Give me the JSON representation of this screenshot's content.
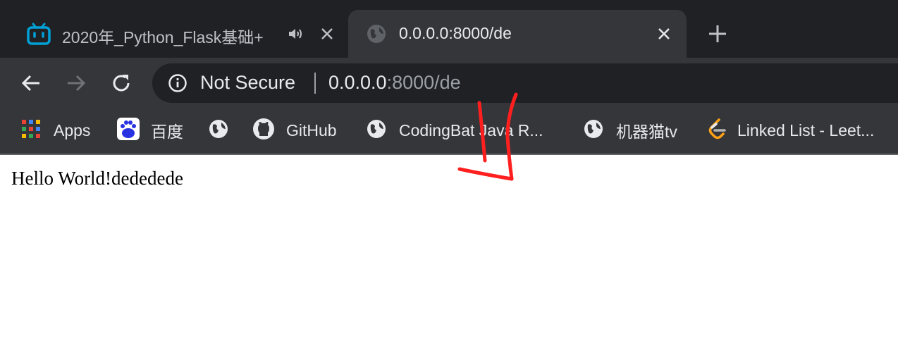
{
  "tabs": [
    {
      "title": "2020年_Python_Flask基础+",
      "favicon": "bilibili-icon",
      "audio": "speaker-icon",
      "close": "×"
    },
    {
      "title": "0.0.0.0:8000/de",
      "favicon": "globe-icon",
      "close": "×"
    }
  ],
  "new_tab": "+",
  "address_bar": {
    "security_label": "Not Secure",
    "url_host": "0.0.0.0",
    "url_rest": ":8000/de"
  },
  "bookmarks": [
    {
      "label": "Apps",
      "icon": "apps-grid-icon"
    },
    {
      "label": "百度",
      "icon": "baidu-icon"
    },
    {
      "label": "",
      "icon": "globe-icon"
    },
    {
      "label": "GitHub",
      "icon": "github-icon"
    },
    {
      "label": "CodingBat Java R...",
      "icon": "globe-icon"
    },
    {
      "label": "机器猫tv",
      "icon": "globe-icon"
    },
    {
      "label": "Linked List - Leet...",
      "icon": "leetcode-icon"
    }
  ],
  "page": {
    "text": "Hello World!dededede"
  },
  "colors": {
    "annotation": "#ff1f1f",
    "chrome_dark": "#202124",
    "chrome_mid": "#35363a"
  }
}
